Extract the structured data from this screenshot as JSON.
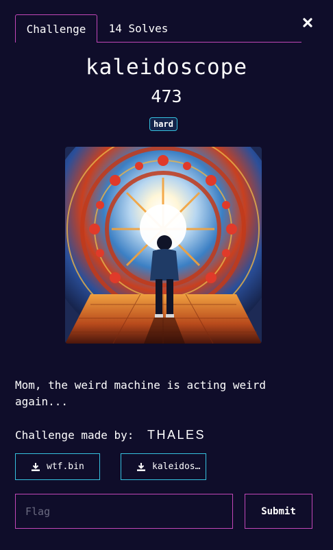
{
  "tabs": {
    "challenge_label": "Challenge",
    "solves_label": "14 Solves"
  },
  "challenge": {
    "name": "kaleidoscope",
    "points": "473",
    "difficulty": "hard",
    "description": "Mom, the weird machine is acting weird again...",
    "made_by_label": "Challenge made by: ",
    "author_logo": "THALES"
  },
  "files": [
    {
      "name": "wtf.bin",
      "icon": "download-icon"
    },
    {
      "name": "kaleidoscope",
      "icon": "download-icon"
    }
  ],
  "form": {
    "flag_placeholder": "Flag",
    "submit_label": "Submit"
  },
  "colors": {
    "background": "#0f0d2a",
    "accent_pink": "#c347b9",
    "accent_cyan": "#36c2e0"
  }
}
